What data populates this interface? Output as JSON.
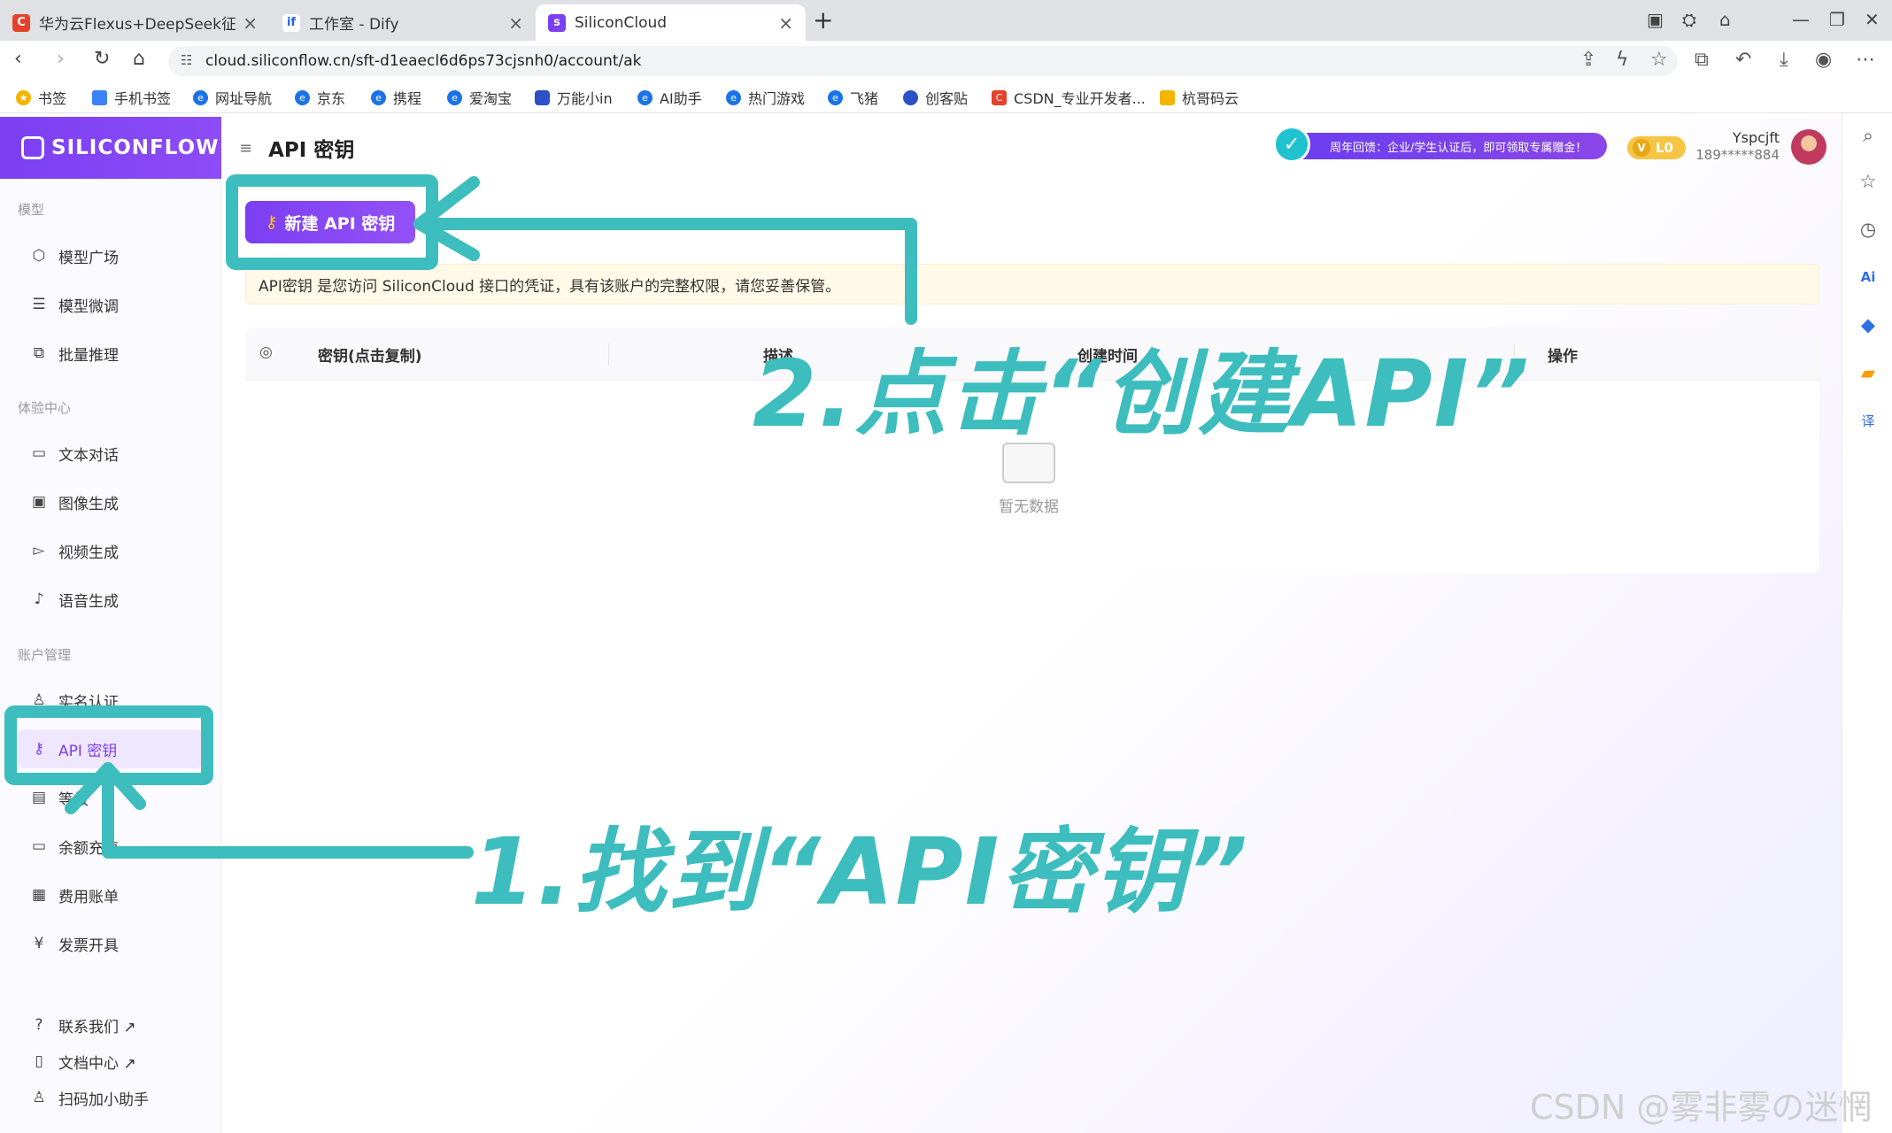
{
  "browser": {
    "tabs": [
      {
        "title": "华为云Flexus+DeepSeek征文 | 自",
        "favicon": "C",
        "color": "#e4422b"
      },
      {
        "title": "工作室 - Dify",
        "favicon": "if",
        "color": "#2563eb"
      },
      {
        "title": "SiliconCloud",
        "favicon": "s",
        "color": "#7b3ff2",
        "active": true
      }
    ],
    "url": "cloud.siliconflow.cn/sft-d1eaecl6d6ps73cjsnh0/account/ak",
    "bookmarks": [
      {
        "label": "书签",
        "color": "#f5b400"
      },
      {
        "label": "手机书签",
        "color": "#3b82f6"
      },
      {
        "label": "网址导航",
        "color": "#1a73e8"
      },
      {
        "label": "京东",
        "color": "#1a73e8"
      },
      {
        "label": "携程",
        "color": "#1a73e8"
      },
      {
        "label": "爱淘宝",
        "color": "#1a73e8"
      },
      {
        "label": "万能小in",
        "color": "#2b50c8"
      },
      {
        "label": "AI助手",
        "color": "#1a73e8"
      },
      {
        "label": "热门游戏",
        "color": "#1a73e8"
      },
      {
        "label": "飞猪",
        "color": "#1a73e8"
      },
      {
        "label": "创客贴",
        "color": "#2b50c8"
      },
      {
        "label": "CSDN_专业开发者...",
        "color": "#e4422b"
      },
      {
        "label": "杭哥码云",
        "color": "#f5b400"
      }
    ]
  },
  "brand": {
    "name": "SILICONFLOW",
    "color": "#7b3ff2"
  },
  "sidebar": {
    "sections": [
      {
        "title": "模型",
        "items": [
          {
            "label": "模型广场",
            "icon": "cube-icon"
          },
          {
            "label": "模型微调",
            "icon": "sliders-icon"
          },
          {
            "label": "批量推理",
            "icon": "copy-icon"
          }
        ]
      },
      {
        "title": "体验中心",
        "items": [
          {
            "label": "文本对话",
            "icon": "chat-icon"
          },
          {
            "label": "图像生成",
            "icon": "image-icon"
          },
          {
            "label": "视频生成",
            "icon": "video-icon"
          },
          {
            "label": "语音生成",
            "icon": "mic-icon"
          }
        ]
      },
      {
        "title": "账户管理",
        "items": [
          {
            "label": "实名认证",
            "icon": "user-check-icon"
          },
          {
            "label": "API 密钥",
            "icon": "key-icon",
            "active": true
          },
          {
            "label": "等级",
            "icon": "wallet-icon"
          },
          {
            "label": "余额充值",
            "icon": "card-icon"
          },
          {
            "label": "费用账单",
            "icon": "bill-icon"
          },
          {
            "label": "发票开具",
            "icon": "invoice-icon"
          }
        ]
      }
    ],
    "footer": [
      {
        "label": "联系我们 ↗",
        "icon": "help-icon"
      },
      {
        "label": "文档中心 ↗",
        "icon": "book-icon"
      },
      {
        "label": "扫码加小助手",
        "icon": "person-icon"
      }
    ]
  },
  "header": {
    "title": "API 密钥",
    "promo": "周年回馈：企业/学生认证后，即可领取专属赠金！",
    "level": "L0",
    "username": "Yspcjft",
    "phone": "189*****884"
  },
  "main": {
    "new_key_button": "新建 API 密钥",
    "notice": "API密钥 是您访问 SiliconCloud 接口的凭证，具有该账户的完整权限，请您妥善保管。",
    "table": {
      "columns": [
        "密钥(点击复制)",
        "描述",
        "创建时间",
        "操作"
      ],
      "empty_text": "暂无数据"
    }
  },
  "annotations": {
    "step1": "1.找到“API密钥”",
    "step2": "2.点击“创建API”",
    "color": "#3dbdbd"
  },
  "watermark": "CSDN @雾非雾の迷惘"
}
